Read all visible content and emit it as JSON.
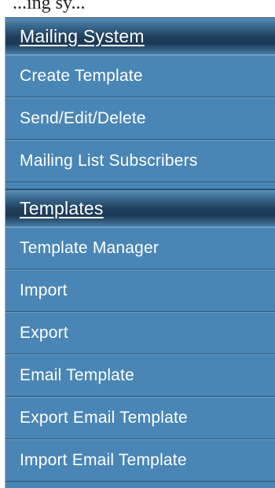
{
  "top_caption": "...ing sy...",
  "sections": [
    {
      "title": "Mailing System",
      "items": [
        {
          "label": "Create Template"
        },
        {
          "label": "Send/Edit/Delete"
        },
        {
          "label": "Mailing List Subscribers"
        }
      ]
    },
    {
      "title": "Templates",
      "items": [
        {
          "label": "Template Manager"
        },
        {
          "label": "Import"
        },
        {
          "label": "Export"
        },
        {
          "label": "Email Template"
        },
        {
          "label": "Export Email Template"
        },
        {
          "label": "Import Email Template"
        }
      ]
    }
  ],
  "colors": {
    "menu_background": "#4a86b5",
    "header_dark": "#1f3f5c",
    "text": "#ffffff"
  }
}
